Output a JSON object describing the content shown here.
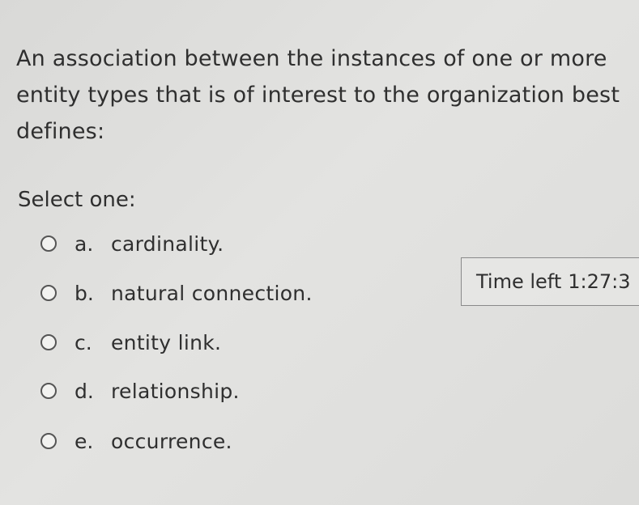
{
  "question": {
    "text": "An association between the instances of one or more entity types that is of interest to the organization best defines:"
  },
  "prompt": "Select one:",
  "options": [
    {
      "letter": "a.",
      "text": "cardinality."
    },
    {
      "letter": "b.",
      "text": "natural connection."
    },
    {
      "letter": "c.",
      "text": "entity link."
    },
    {
      "letter": "d.",
      "text": "relationship."
    },
    {
      "letter": "e.",
      "text": "occurrence."
    }
  ],
  "timer": {
    "label": "Time left",
    "value": "1:27:3"
  }
}
